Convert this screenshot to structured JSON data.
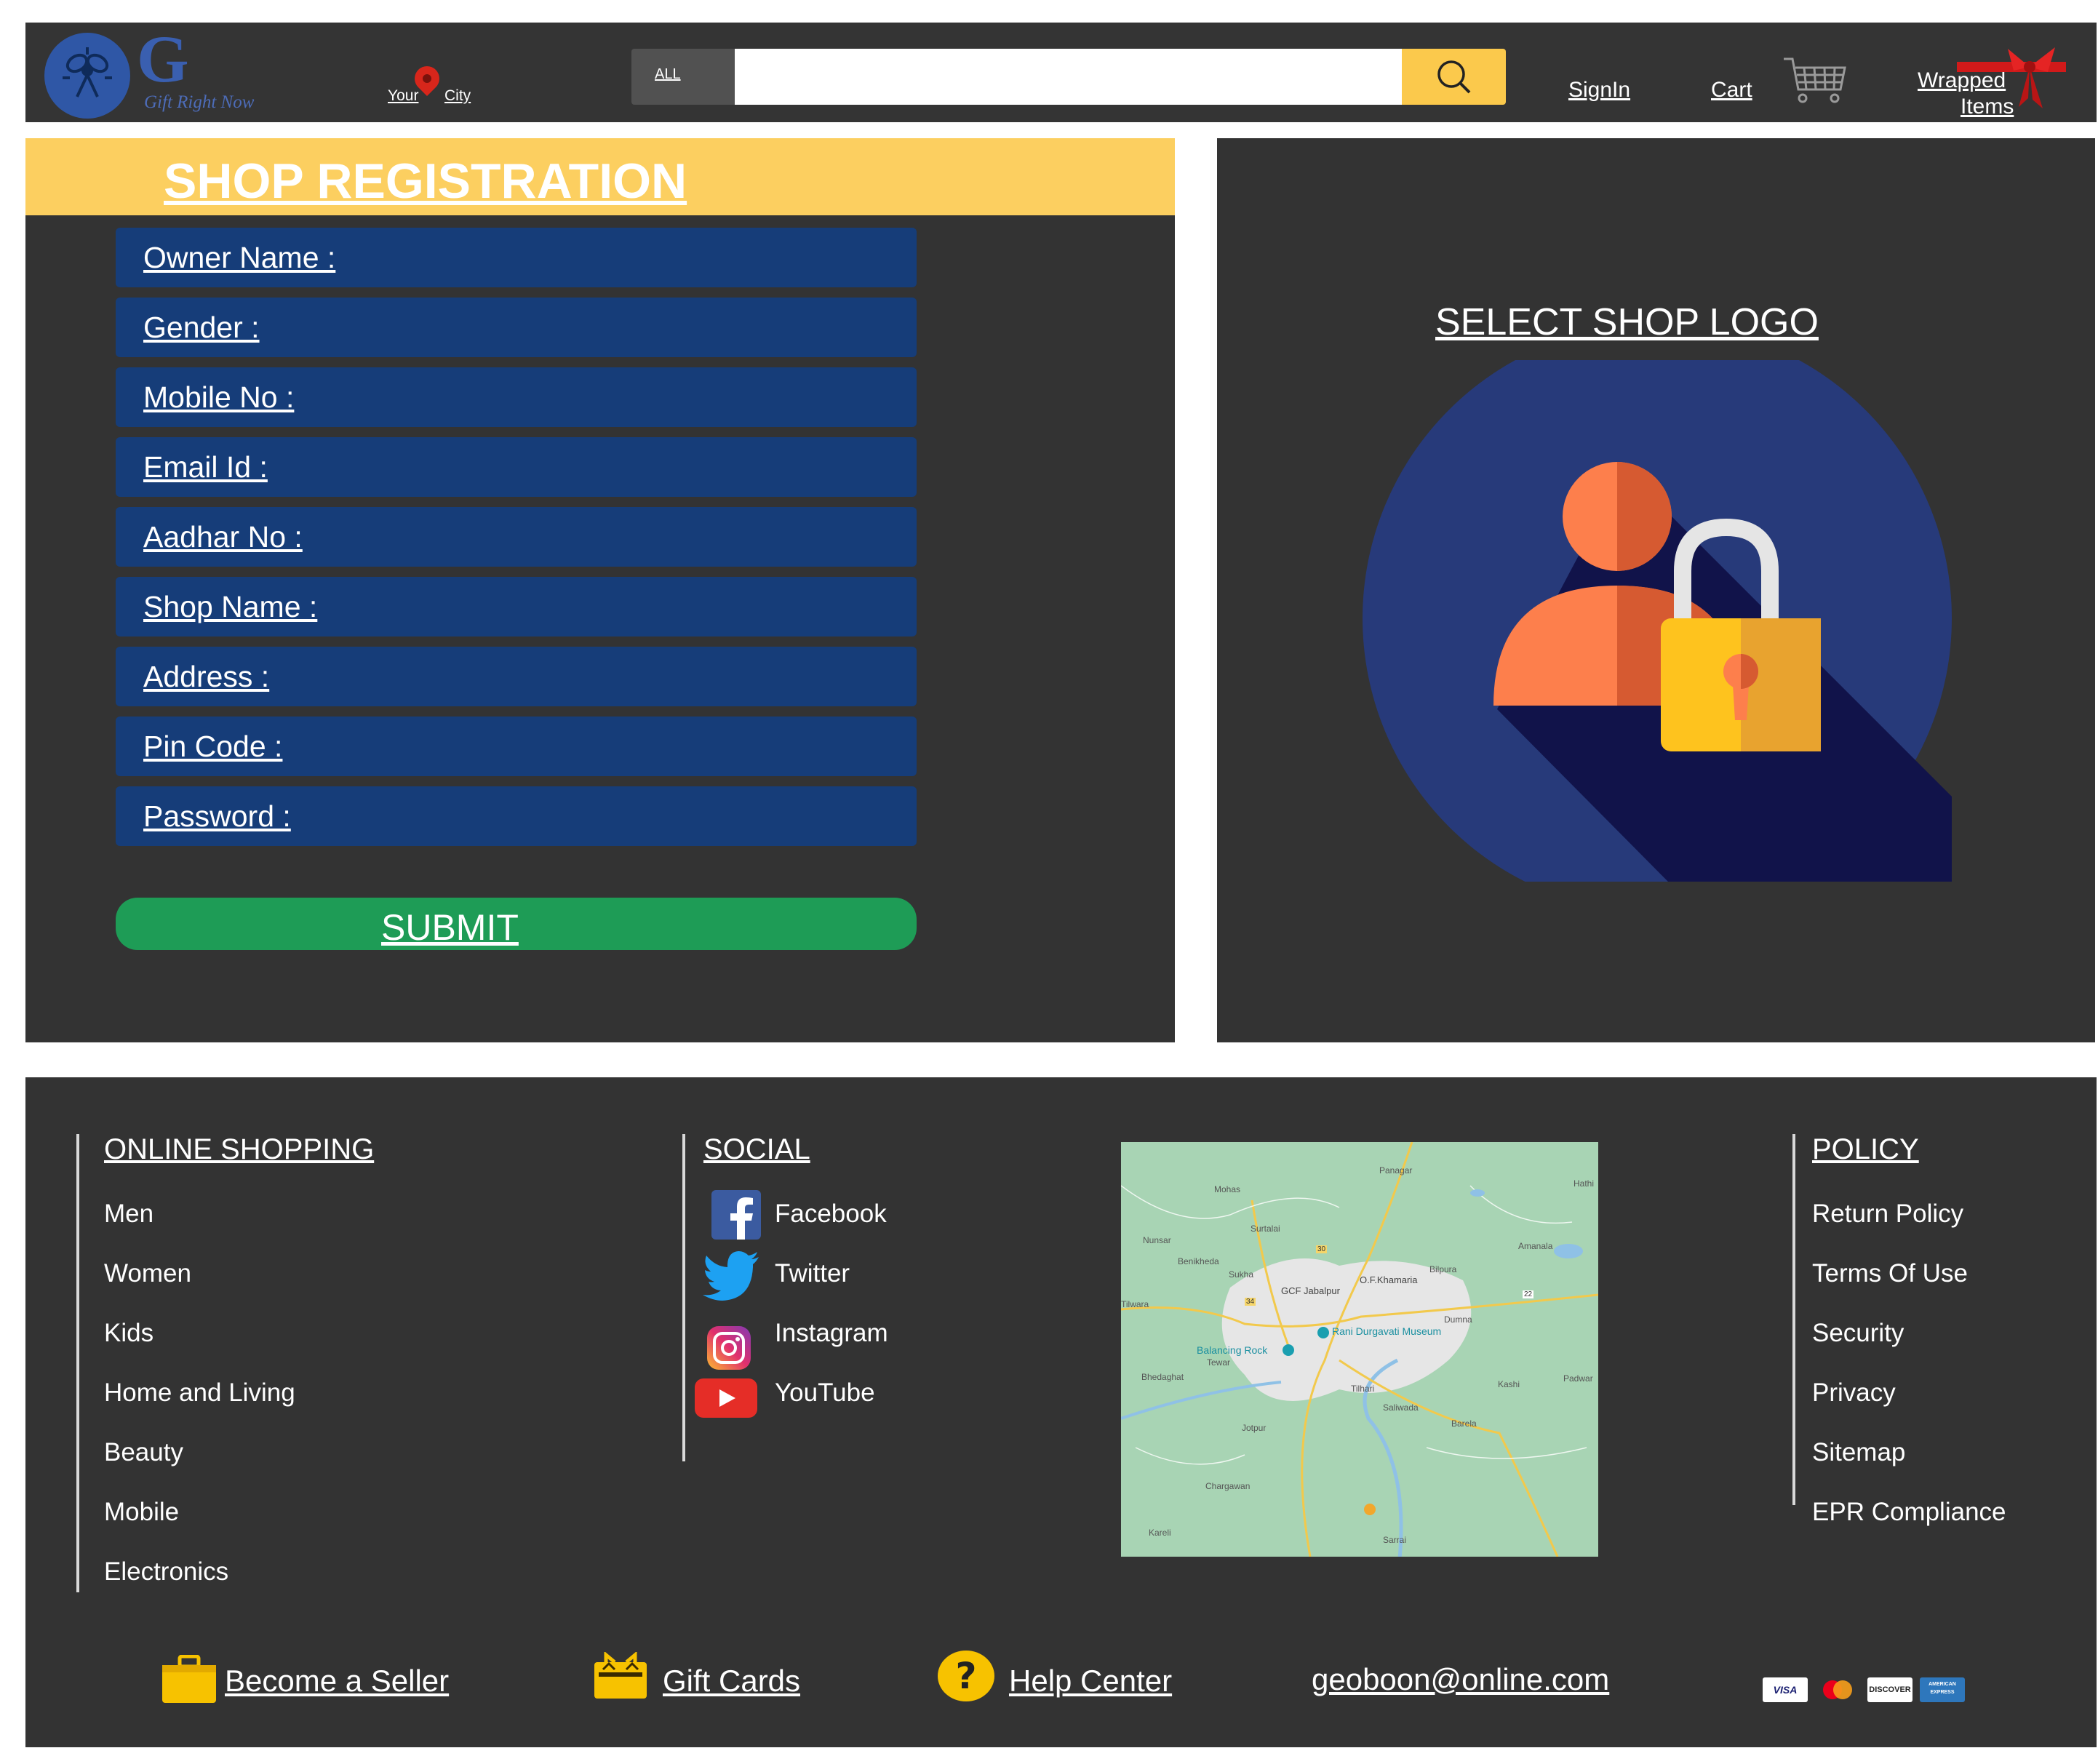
{
  "header": {
    "logo_letter": "G",
    "logo_tagline": "Gift Right Now",
    "location": {
      "your": "Your",
      "city": "City"
    },
    "search": {
      "category": "ALL",
      "value": "",
      "placeholder": ""
    },
    "signin_label": "SignIn",
    "cart_label": "Cart",
    "wrapped_line1": "Wrapped",
    "wrapped_line2": "Items"
  },
  "registration": {
    "title": "SHOP REGISTRATION",
    "fields": [
      {
        "label": "Owner Name :"
      },
      {
        "label": "Gender :"
      },
      {
        "label": "Mobile No :"
      },
      {
        "label": "Email Id :"
      },
      {
        "label": "Aadhar No :"
      },
      {
        "label": "Shop Name :"
      },
      {
        "label": "Address :"
      },
      {
        "label": "Pin Code :"
      },
      {
        "label": "Password :"
      }
    ],
    "submit_label": "SUBMIT"
  },
  "logo_panel": {
    "title": "SELECT SHOP LOGO"
  },
  "footer": {
    "online_shopping": {
      "heading": "ONLINE SHOPPING",
      "items": [
        "Men",
        "Women",
        "Kids",
        "Home and Living",
        "Beauty",
        "Mobile",
        "Electronics"
      ]
    },
    "social": {
      "heading": "SOCIAL",
      "items": [
        "Facebook",
        "Twitter",
        "Instagram",
        "YouTube"
      ]
    },
    "map": {
      "labels": [
        "Panagar",
        "Mohas",
        "Surtalai",
        "Nunsar",
        "Benikheda",
        "Sukha",
        "O.F.Khamaria",
        "Bilpura",
        "Amanala",
        "GCF Jabalpur",
        "Tilwara",
        "Rani Durgavati Museum",
        "Dumna",
        "Balancing Rock",
        "Tewar",
        "Bhedaghat",
        "Kashi",
        "Padwar",
        "Tilhari",
        "Saliwada",
        "Barela",
        "Jotpur",
        "Chargawan",
        "Kareli",
        "Sarrai",
        "Hathi"
      ],
      "road_numbers": [
        "30",
        "34",
        "22"
      ]
    },
    "policy": {
      "heading": "POLICY",
      "items": [
        "Return Policy",
        "Terms Of Use",
        "Security",
        "Privacy",
        "Sitemap",
        "EPR Compliance"
      ]
    },
    "bottom": {
      "become_seller": "Become a Seller",
      "gift_cards": "Gift Cards",
      "help_center": "Help Center",
      "email": "geoboon@online.com"
    },
    "payment_cards": [
      "VISA",
      "MasterCard",
      "DISCOVER",
      "AMERICAN EXPRESS"
    ]
  },
  "colors": {
    "dark_bg": "#333333",
    "accent_yellow": "#fccf60",
    "field_blue": "#163d79",
    "submit_green": "#1e9c56"
  }
}
